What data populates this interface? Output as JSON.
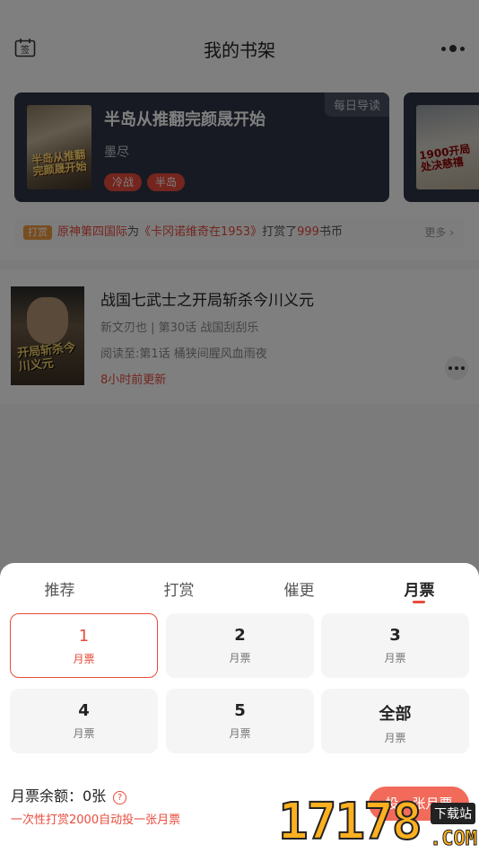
{
  "header": {
    "title": "我的书架",
    "left_icon": "checkin-calendar-icon",
    "left_icon_text": "签",
    "right_icon": "more-dots-icon"
  },
  "banner": {
    "card": {
      "title": "半岛从推翻完颜晟开始",
      "author": "墨尽",
      "tags": [
        "冷战",
        "半岛"
      ],
      "corner_label": "每日导读",
      "cover_text": "半岛从推翻完颜晟开始"
    },
    "next_card": {
      "cover_text": "1900开局处决慈禧"
    },
    "reward_bar": {
      "badge": "打赏",
      "user": "原神第四国际",
      "text_1": "为",
      "book": "《卡冈诺维奇在1953》",
      "text_2": "打赏了",
      "amount": "999",
      "text_3": "书币",
      "more": "更多"
    }
  },
  "book": {
    "title": "战国七武士之开局斩杀今川义元",
    "meta": "新文刃也 | 第30话 战国刮刮乐",
    "progress": "阅读至:第1话 桶狭间腥风血雨夜",
    "updated": "8小时前更新",
    "cover_text": "开局斩杀今川义元"
  },
  "sheet": {
    "tabs": [
      "推荐",
      "打赏",
      "催更",
      "月票"
    ],
    "active_tab": "月票",
    "options": [
      {
        "num": "1",
        "unit": "月票",
        "selected": true
      },
      {
        "num": "2",
        "unit": "月票",
        "selected": false
      },
      {
        "num": "3",
        "unit": "月票",
        "selected": false
      },
      {
        "num": "4",
        "unit": "月票",
        "selected": false
      },
      {
        "num": "5",
        "unit": "月票",
        "selected": false
      },
      {
        "num": "全部",
        "unit": "月票",
        "selected": false
      }
    ],
    "balance": "月票余额：0张",
    "help": "?",
    "hint": "一次性打赏2000自动投一张月票",
    "vote_button": "投一张月票"
  },
  "watermark": {
    "digits": "17178",
    "site": "下载站",
    "com": ".COM"
  },
  "colors": {
    "accent": "#e84b3c",
    "banner_bg": "#2f3545",
    "reward_badge": "#f19a3e"
  }
}
